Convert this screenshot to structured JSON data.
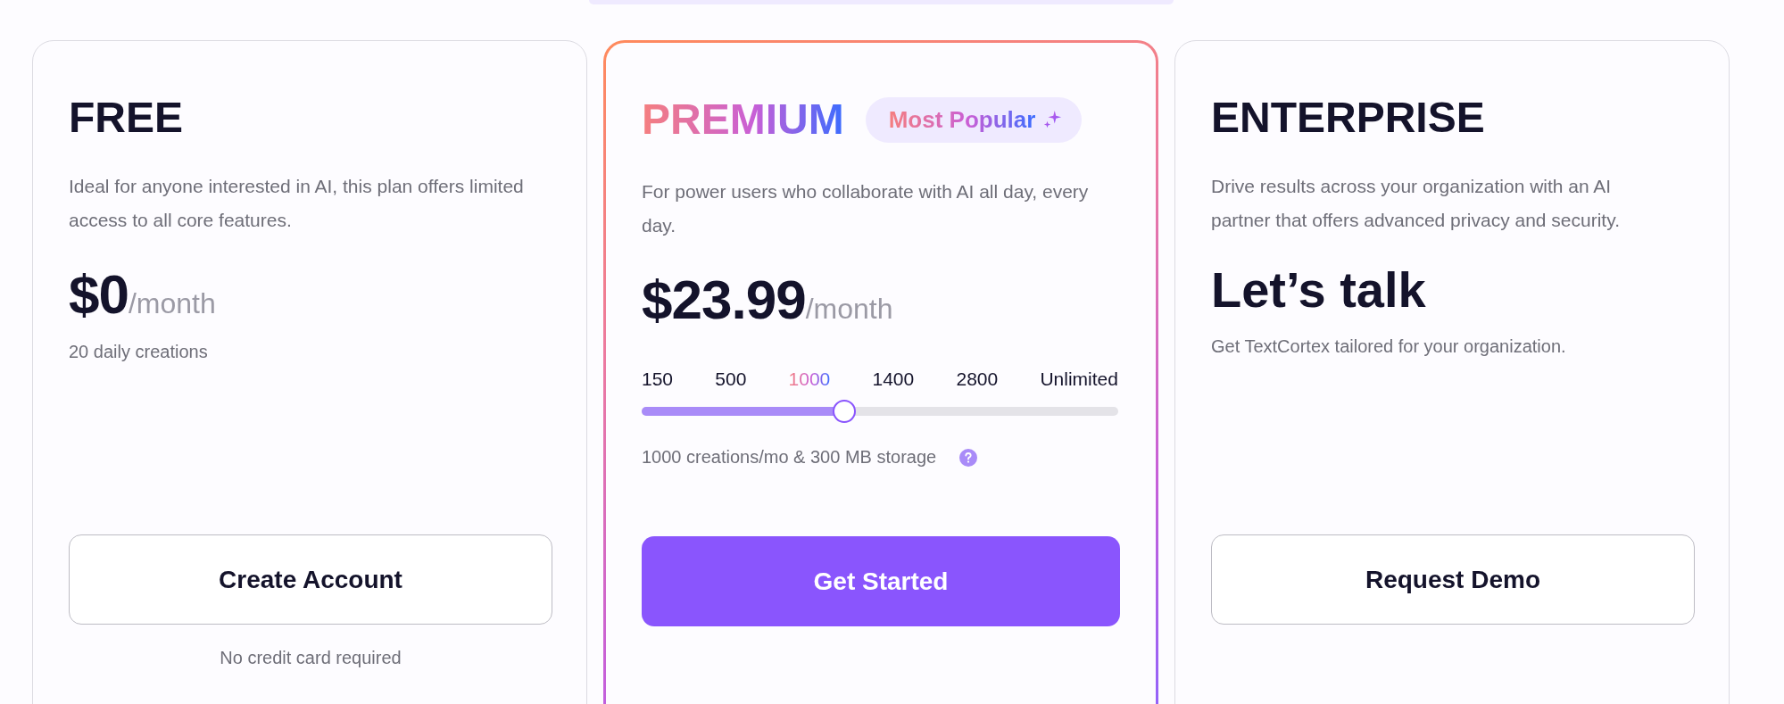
{
  "plans": [
    {
      "kind": "free",
      "name": "FREE",
      "description": "Ideal for anyone interested in AI, this plan offers limited access to all core features.",
      "price": "$0",
      "period": "/month",
      "note": "20 daily creations",
      "button": {
        "label": "Create Account",
        "primary": false
      },
      "footnote": "No credit card required"
    },
    {
      "kind": "premium",
      "name": "PREMIUM",
      "badge": "Most Popular",
      "description": "For power users who collaborate with AI all day, every day.",
      "price": "$23.99",
      "period": "/month",
      "slider": {
        "level": 0.406,
        "stops": [
          {
            "label": "150",
            "selected": false
          },
          {
            "label": "500",
            "selected": false
          },
          {
            "label": "1000",
            "selected": true
          },
          {
            "label": "1400",
            "selected": false
          },
          {
            "label": "2800",
            "selected": false
          },
          {
            "label": "Unlimited",
            "selected": false
          }
        ]
      },
      "note": "1000 creations/mo & 300 MB storage",
      "button": {
        "label": "Get Started",
        "primary": true
      }
    },
    {
      "kind": "enterprise",
      "name": "ENTERPRISE",
      "description": "Drive results across your organization with an AI partner that offers advanced privacy and security.",
      "headline": "Let’s talk",
      "note": "Get TextCortex tailored for your organization.",
      "button": {
        "label": "Request Demo",
        "primary": false
      }
    }
  ]
}
